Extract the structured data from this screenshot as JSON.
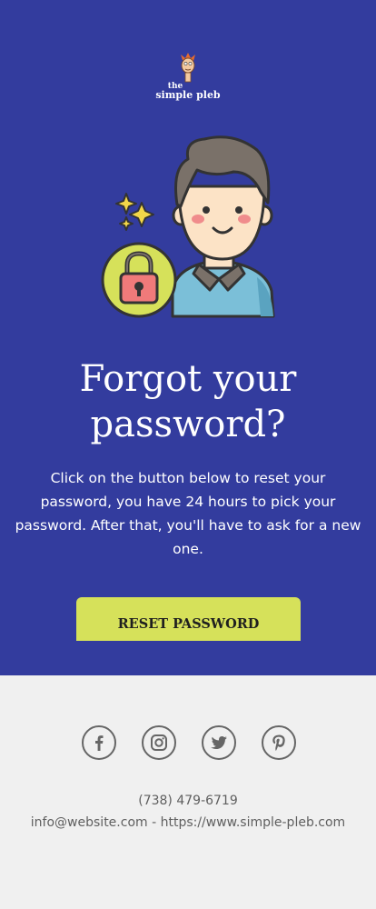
{
  "header": {
    "logo": {
      "small_word": "the",
      "main_text": "simple pleb",
      "icon": "pleb-face-logo"
    }
  },
  "hero": {
    "illustration_icon": "user-with-padlock",
    "title_line1": "Forgot your",
    "title_line2": "password?",
    "body": "Click on the button below to reset your password, you have 24 hours to pick your password. After that, you'll have to ask for a new one.",
    "button_label": "RESET PASSWORD",
    "background_color": "#333c9e",
    "button_color": "#d6e15a"
  },
  "footer": {
    "social": [
      {
        "name": "facebook",
        "icon": "facebook-icon"
      },
      {
        "name": "instagram",
        "icon": "instagram-icon"
      },
      {
        "name": "twitter",
        "icon": "twitter-icon"
      },
      {
        "name": "pinterest",
        "icon": "pinterest-icon"
      }
    ],
    "phone": "(738) 479-6719",
    "email": "info@website.com",
    "separator": " - ",
    "website": "https://www.simple-pleb.com",
    "background_color": "#f0f0f0"
  }
}
